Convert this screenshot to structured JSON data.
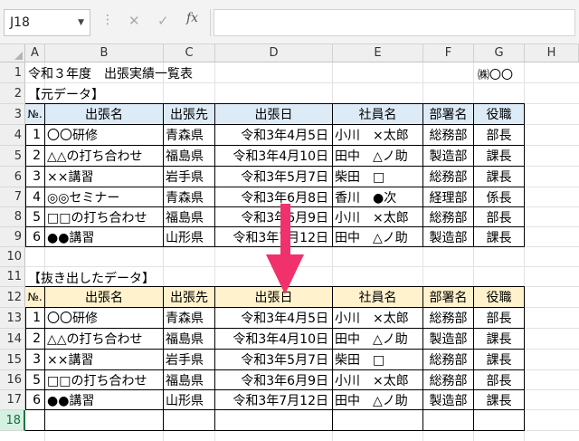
{
  "formula_bar": {
    "name_box": "J18",
    "cancel_icon": "✕",
    "enter_icon": "✓",
    "fx_label": "fx",
    "formula": ""
  },
  "columns": [
    "A",
    "B",
    "C",
    "D",
    "E",
    "F",
    "G",
    "H"
  ],
  "rows": [
    "1",
    "2",
    "3",
    "4",
    "5",
    "6",
    "7",
    "8",
    "9",
    "10",
    "11",
    "12",
    "13",
    "14",
    "15",
    "16",
    "17",
    "18"
  ],
  "selected_row": "18",
  "title": "令和３年度　出張実績一覧表",
  "company": "㈱〇〇",
  "source_label": "【元データ】",
  "extract_label": "【抜き出したデータ】",
  "headers": [
    "№.",
    "出張名",
    "出張先",
    "出張日",
    "社員名",
    "部署名",
    "役職"
  ],
  "source_rows": [
    [
      "1",
      "〇〇研修",
      "青森県",
      "令和3年4月5日",
      "小川　×太郎",
      "総務部",
      "部長"
    ],
    [
      "2",
      "△△の打ち合わせ",
      "福島県",
      "令和3年4月10日",
      "田中　△ノ助",
      "製造部",
      "課長"
    ],
    [
      "3",
      "××講習",
      "岩手県",
      "令和3年5月7日",
      "柴田　□",
      "総務部",
      "課長"
    ],
    [
      "4",
      "◎◎セミナー",
      "青森県",
      "令和3年6月8日",
      "香川　●次",
      "経理部",
      "係長"
    ],
    [
      "5",
      "□□の打ち合わせ",
      "福島県",
      "令和3年6月9日",
      "小川　×太郎",
      "総務部",
      "部長"
    ],
    [
      "6",
      "●●講習",
      "山形県",
      "令和3年7月12日",
      "田中　△ノ助",
      "製造部",
      "課長"
    ]
  ],
  "extracted_rows": [
    [
      "1",
      "〇〇研修",
      "青森県",
      "令和3年4月5日",
      "小川　×太郎",
      "総務部",
      "部長"
    ],
    [
      "2",
      "△△の打ち合わせ",
      "福島県",
      "令和3年4月10日",
      "田中　△ノ助",
      "製造部",
      "課長"
    ],
    [
      "3",
      "××講習",
      "岩手県",
      "令和3年5月7日",
      "柴田　□",
      "総務部",
      "課長"
    ],
    [
      "5",
      "□□の打ち合わせ",
      "福島県",
      "令和3年6月9日",
      "小川　×太郎",
      "総務部",
      "部長"
    ],
    [
      "6",
      "●●講習",
      "山形県",
      "令和3年7月12日",
      "田中　△ノ助",
      "製造部",
      "課長"
    ]
  ],
  "colors": {
    "source_header_fill": "#ddebf7",
    "extract_header_fill": "#fff2cc",
    "arrow": "#f0316b",
    "selection": "#217346"
  }
}
